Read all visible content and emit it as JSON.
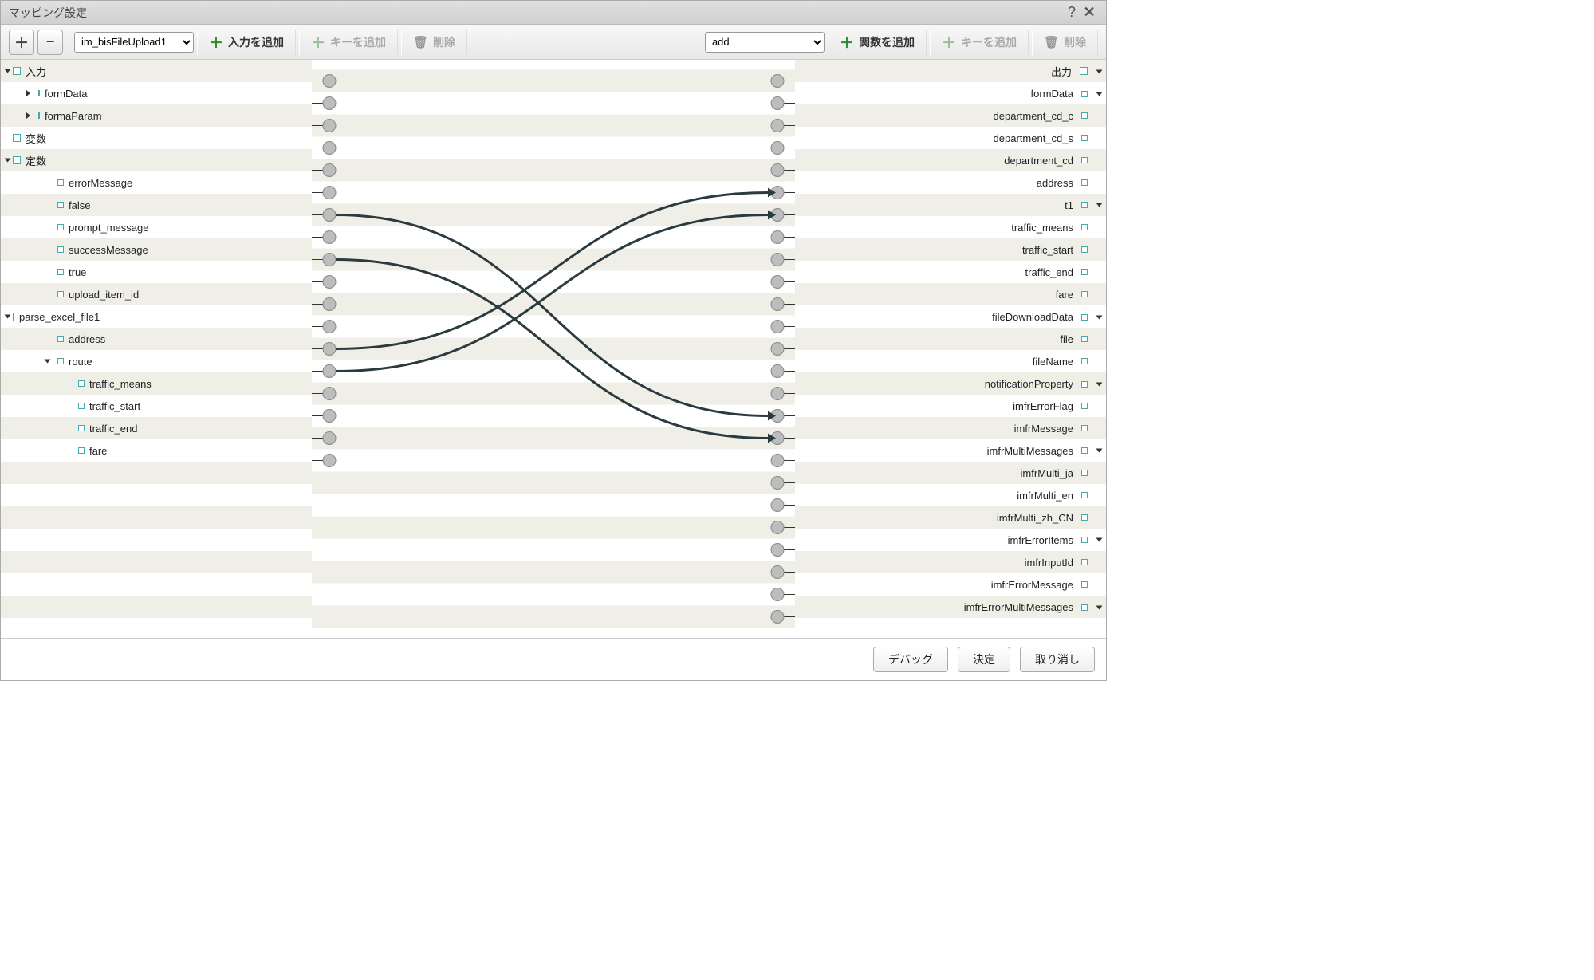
{
  "title": "マッピング設定",
  "toolbar": {
    "input_dropdown_value": "im_bisFileUpload1",
    "add_input_label": "入力を追加",
    "add_input_key_label": "キーを追加",
    "delete_input_label": "削除",
    "func_dropdown_value": "add",
    "add_func_label": "関数を追加",
    "add_output_key_label": "キーを追加",
    "delete_output_label": "削除"
  },
  "left_tree": [
    {
      "name": "入力",
      "type": "<object>",
      "indent": 0,
      "expand": "down",
      "icon": "sq"
    },
    {
      "name": "formData",
      "type": "<object>",
      "indent": 1,
      "expand": "right",
      "icon": "dsq"
    },
    {
      "name": "formaParam",
      "type": "<object>",
      "indent": 1,
      "expand": "right",
      "icon": "dsq"
    },
    {
      "name": "変数",
      "type": "<object>",
      "indent": 0,
      "expand": "",
      "icon": "sq"
    },
    {
      "name": "定数",
      "type": "<object>",
      "indent": 0,
      "expand": "down",
      "icon": "sq"
    },
    {
      "name": "errorMessage",
      "type": "<string>",
      "indent": 2,
      "expand": "",
      "icon": "dsq"
    },
    {
      "name": "false",
      "type": "<string>",
      "indent": 2,
      "expand": "",
      "icon": "dsq"
    },
    {
      "name": "prompt_message",
      "type": "<string>",
      "indent": 2,
      "expand": "",
      "icon": "dsq"
    },
    {
      "name": "successMessage",
      "type": "<string>",
      "indent": 2,
      "expand": "",
      "icon": "dsq"
    },
    {
      "name": "true",
      "type": "<string>",
      "indent": 2,
      "expand": "",
      "icon": "dsq"
    },
    {
      "name": "upload_item_id",
      "type": "<string>",
      "indent": 2,
      "expand": "",
      "icon": "dsq"
    },
    {
      "name": "parse_excel_file1",
      "type": "<object>",
      "indent": 0,
      "expand": "down",
      "icon": "sq"
    },
    {
      "name": "address",
      "type": "<string>",
      "indent": 2,
      "expand": "",
      "icon": "dsq"
    },
    {
      "name": "route",
      "type": "<object[]>",
      "indent": 2,
      "expand": "down",
      "icon": "dsq"
    },
    {
      "name": "traffic_means",
      "type": "<string>",
      "indent": 3,
      "expand": "",
      "icon": "dsq"
    },
    {
      "name": "traffic_start",
      "type": "<string>",
      "indent": 3,
      "expand": "",
      "icon": "dsq"
    },
    {
      "name": "traffic_end",
      "type": "<string>",
      "indent": 3,
      "expand": "",
      "icon": "dsq"
    },
    {
      "name": "fare",
      "type": "<double>",
      "indent": 3,
      "expand": "",
      "icon": "dsq"
    }
  ],
  "right_tree": [
    {
      "name": "出力",
      "type": "<object>",
      "expand": "down",
      "icon": "sq"
    },
    {
      "name": "formData",
      "type": "<object>",
      "expand": "down",
      "icon": "dsq"
    },
    {
      "name": "department_cd_c",
      "type": "<string>",
      "expand": "",
      "icon": "dsq"
    },
    {
      "name": "department_cd_s",
      "type": "<string>",
      "expand": "",
      "icon": "dsq"
    },
    {
      "name": "department_cd",
      "type": "<string>",
      "expand": "",
      "icon": "dsq"
    },
    {
      "name": "address",
      "type": "<string>",
      "expand": "",
      "icon": "dsq"
    },
    {
      "name": "t1",
      "type": "<object[]>",
      "expand": "down",
      "icon": "dsq"
    },
    {
      "name": "traffic_means",
      "type": "<string>",
      "expand": "",
      "icon": "dsq"
    },
    {
      "name": "traffic_start",
      "type": "<string>",
      "expand": "",
      "icon": "dsq"
    },
    {
      "name": "traffic_end",
      "type": "<string>",
      "expand": "",
      "icon": "dsq"
    },
    {
      "name": "fare",
      "type": "<bigdecimal>",
      "expand": "",
      "icon": "dsq"
    },
    {
      "name": "fileDownloadData",
      "type": "<object>",
      "expand": "down",
      "icon": "dsq"
    },
    {
      "name": "file",
      "type": "<storage>",
      "expand": "",
      "icon": "dsq"
    },
    {
      "name": "fileName",
      "type": "<string>",
      "expand": "",
      "icon": "dsq"
    },
    {
      "name": "notificationProperty",
      "type": "<object>",
      "expand": "down",
      "icon": "dsq"
    },
    {
      "name": "imfrErrorFlag",
      "type": "<boolean>",
      "expand": "",
      "icon": "dsq"
    },
    {
      "name": "imfrMessage",
      "type": "<string[]>",
      "expand": "",
      "icon": "dsq"
    },
    {
      "name": "imfrMultiMessages",
      "type": "<object[]>",
      "expand": "down",
      "icon": "dsq"
    },
    {
      "name": "imfrMulti_ja",
      "type": "<string>",
      "expand": "",
      "icon": "dsq"
    },
    {
      "name": "imfrMulti_en",
      "type": "<string>",
      "expand": "",
      "icon": "dsq"
    },
    {
      "name": "imfrMulti_zh_CN",
      "type": "<string>",
      "expand": "",
      "icon": "dsq"
    },
    {
      "name": "imfrErrorItems",
      "type": "<object[]>",
      "expand": "down",
      "icon": "dsq"
    },
    {
      "name": "imfrInputId",
      "type": "<string[]>",
      "expand": "",
      "icon": "dsq"
    },
    {
      "name": "imfrErrorMessage",
      "type": "<string>",
      "expand": "",
      "icon": "dsq"
    },
    {
      "name": "imfrErrorMultiMessages",
      "type": "<object>",
      "expand": "down",
      "icon": "dsq"
    }
  ],
  "wires": [
    {
      "from": 6,
      "to": 15
    },
    {
      "from": 8,
      "to": 16
    },
    {
      "from": 12,
      "to": 5
    },
    {
      "from": 13,
      "to": 6
    }
  ],
  "footer": {
    "debug": "デバッグ",
    "ok": "決定",
    "cancel": "取り消し"
  }
}
